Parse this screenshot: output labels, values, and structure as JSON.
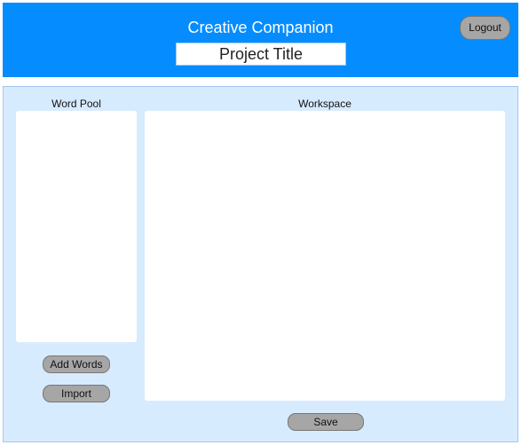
{
  "header": {
    "app_title": "Creative Companion",
    "project_title_value": "Project Title",
    "logout_label": "Logout"
  },
  "word_pool": {
    "label": "Word Pool",
    "add_words_label": "Add Words",
    "import_label": "Import"
  },
  "workspace": {
    "label": "Workspace",
    "save_label": "Save"
  },
  "colors": {
    "header_bg": "#058cff",
    "main_bg": "#d7ebff",
    "button_bg": "#a6a6a6"
  }
}
